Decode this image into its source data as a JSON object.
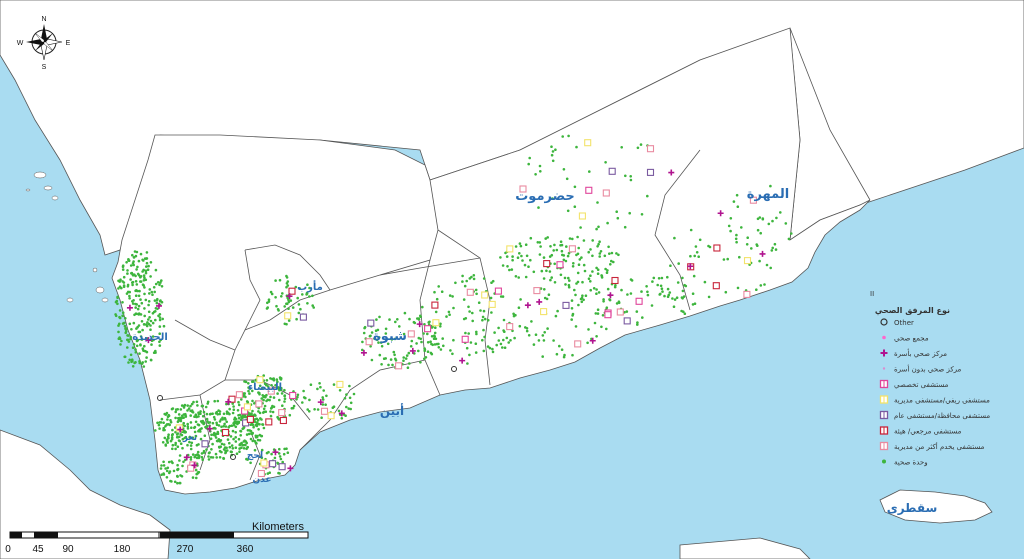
{
  "colors": {
    "sea": "#a9dcf1",
    "land": "#ffffff",
    "border": "#555555",
    "label": "#2a6db3",
    "unit_dot": "#3db53d",
    "complex": "#ff66cc",
    "center_beds": "#b0138f",
    "center_nobeds": "#d98ed0",
    "specialized": "#e0449a",
    "rural": "#f3e36b",
    "governorate": "#7a5aa0",
    "referral": "#c8243a",
    "multi_district": "#e98aa0"
  },
  "compass": {
    "north": "N",
    "south": "S",
    "east": "E",
    "west": "W"
  },
  "regions": {
    "hadramawt": "حضرموت",
    "mahra": "المهرة",
    "shabwa": "شبوة",
    "abyan": "أبين",
    "socotra": "سقطرى",
    "marib": "مأرب",
    "hudaydah": "الحديدة",
    "bayda": "البيضاء",
    "lahj": "لحج",
    "aden": "عدن",
    "taiz": "تعز"
  },
  "legend": {
    "marker": "II",
    "title": "نوع المرفق الصحي",
    "items": [
      {
        "label": "Other",
        "symbol": "ring"
      },
      {
        "label": "مجمع صحي",
        "symbol": "small-dot"
      },
      {
        "label": "مركز صحي بأسرة",
        "symbol": "plus"
      },
      {
        "label": "مركز صحي بدون أسرة",
        "symbol": "tiny-dot"
      },
      {
        "label": "مستشفى تخصصي",
        "symbol": "box-pink"
      },
      {
        "label": "مستشفى ريفي/مستشفى مديرية",
        "symbol": "box-yellow"
      },
      {
        "label": "مستشفى محافظة/مستشفى عام",
        "symbol": "box-purple"
      },
      {
        "label": "مستشفى مرجعي/ هيئة",
        "symbol": "box-red"
      },
      {
        "label": "مستشفى يخدم أكثر من مديرية",
        "symbol": "box-rose"
      },
      {
        "label": "وحدة صحية",
        "symbol": "green-dot"
      }
    ]
  },
  "scale": {
    "unit": "Kilometers",
    "ticks": [
      "0",
      "45",
      "90",
      "180",
      "270",
      "360"
    ]
  }
}
